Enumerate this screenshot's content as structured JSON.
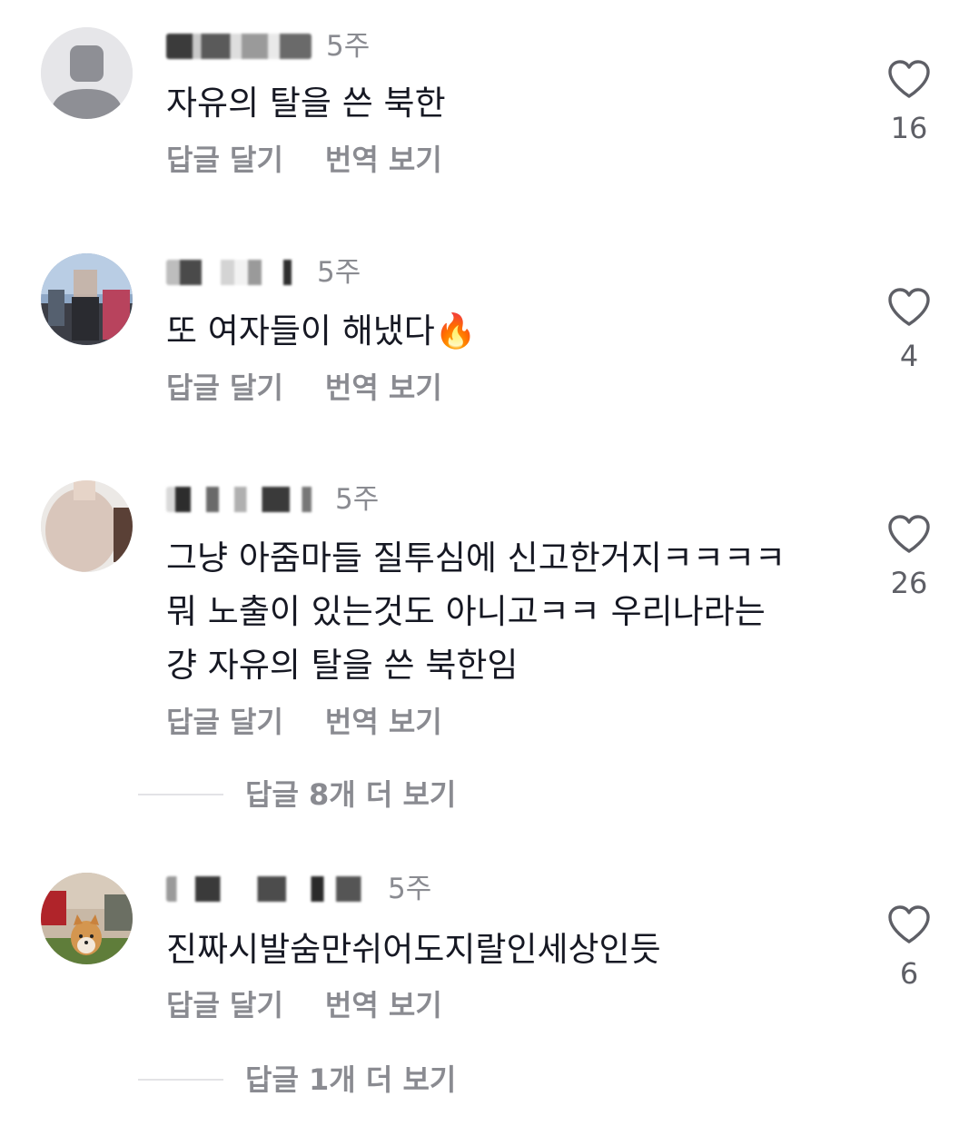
{
  "comments": [
    {
      "time": "5주",
      "text": "자유의 탈을 쓴 북한",
      "reply_label": "답글 달기",
      "translate_label": "번역 보기",
      "likes": "16",
      "avatar_icon": "default-user-icon"
    },
    {
      "time": "5주",
      "text": "또 여자들이 해냈다🔥",
      "reply_label": "답글 달기",
      "translate_label": "번역 보기",
      "likes": "4",
      "avatar_icon": "photo-avatar"
    },
    {
      "time": "5주",
      "text": "그냥 아줌마들 질투심에 신고한거지ㅋㅋㅋㅋ\n뭐 노출이 있는것도 아니고ㅋㅋ 우리나라는\n걍 자유의 탈을 쓴 북한임",
      "reply_label": "답글 달기",
      "translate_label": "번역 보기",
      "likes": "26",
      "avatar_icon": "photo-avatar",
      "more_replies": "답글 8개 더 보기"
    },
    {
      "time": "5주",
      "text": "진짜시발숨만쉬어도지랄인세상인듯",
      "reply_label": "답글 달기",
      "translate_label": "번역 보기",
      "likes": "6",
      "avatar_icon": "dog-photo-avatar",
      "more_replies": "답글 1개 더 보기"
    }
  ],
  "colors": {
    "text": "#161823",
    "secondary": "#8a8b91",
    "divider": "#e3e3e6"
  }
}
